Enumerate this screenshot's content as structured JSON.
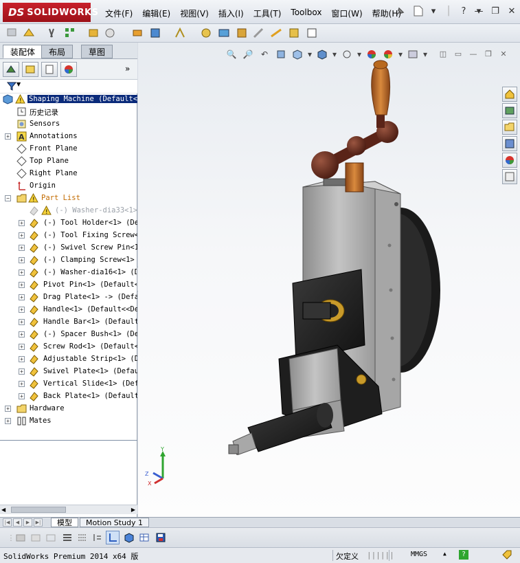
{
  "app": {
    "logo_prefix": "DS",
    "logo_name": "SOLIDWORKS"
  },
  "menu": [
    {
      "label": "文件(F)"
    },
    {
      "label": "编辑(E)"
    },
    {
      "label": "视图(V)"
    },
    {
      "label": "插入(I)"
    },
    {
      "label": "工具(T)"
    },
    {
      "label": "Toolbox"
    },
    {
      "label": "窗口(W)"
    },
    {
      "label": "帮助(H)"
    }
  ],
  "left_tabs": {
    "assembly": "装配体",
    "layout": "布局",
    "sketch": "草图"
  },
  "tree": [
    {
      "label": "Shaping Machine  (Default<"
    },
    {
      "label": "历史记录"
    },
    {
      "label": "Sensors"
    },
    {
      "label": "Annotations"
    },
    {
      "label": "Front Plane"
    },
    {
      "label": "Top Plane"
    },
    {
      "label": "Right Plane"
    },
    {
      "label": "Origin"
    },
    {
      "label": "Part List"
    },
    {
      "label": "(-) Washer-dia33<1>"
    },
    {
      "label": "(-) Tool Holder<1> (Def"
    },
    {
      "label": "(-) Tool Fixing Screw<1"
    },
    {
      "label": "(-) Swivel Screw Pin<1>"
    },
    {
      "label": "(-) Clamping Screw<1>"
    },
    {
      "label": "(-) Washer-dia16<1> (De"
    },
    {
      "label": "Pivot Pin<1> (Default<<"
    },
    {
      "label": "Drag Plate<1> -> (Defa"
    },
    {
      "label": "Handle<1> (Default<<Def"
    },
    {
      "label": "Handle Bar<1> (Default<"
    },
    {
      "label": "(-) Spacer Bush<1> (De"
    },
    {
      "label": "Screw Rod<1> (Default<<"
    },
    {
      "label": "Adjustable Strip<1> (De"
    },
    {
      "label": "Swivel Plate<1> (Defaul"
    },
    {
      "label": "Vertical Slide<1> (Defa"
    },
    {
      "label": "Back Plate<1> (Default<"
    },
    {
      "label": "Hardware"
    },
    {
      "label": "Mates"
    }
  ],
  "bottom_tabs": {
    "model": "模型",
    "motion_study": "Motion Study 1"
  },
  "status": {
    "product": "SolidWorks Premium 2014 x64 版",
    "state": "欠定义",
    "units": "MMGS",
    "units_arrow": "▲",
    "help": "?"
  },
  "triad": {
    "x": "X",
    "y": "Y",
    "z": "Z"
  },
  "colors": {
    "selection": "#0a2a7a",
    "logo_red": "#c8202b",
    "part_body": "#b8b8b8",
    "part_dark": "#1e1e1e",
    "knob_brown": "#6a2c1e",
    "handle_wood": "#c1712e"
  }
}
